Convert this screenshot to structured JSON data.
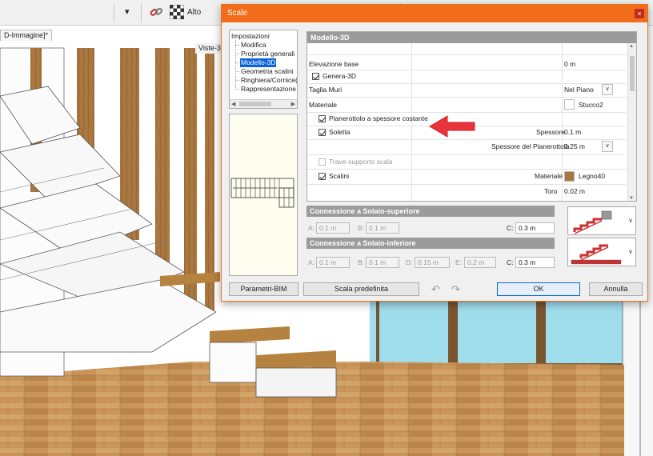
{
  "toolbar": {
    "view_label": "Alto",
    "dropdown_arrow": "▾",
    "icons": [
      "chain-link-icon",
      "checkerboard-icon"
    ]
  },
  "document_tab": "D-Immagine]*",
  "view_name": "Viste-3D",
  "dialog": {
    "title": "Scale",
    "close_glyph": "×",
    "tree": {
      "root": "Impostazioni",
      "items": [
        "Modifica",
        "Proprietà generali",
        "Modello-3D",
        "Geometria scalini",
        "Ringhiera/Cornice(+",
        "Rappresentazione s"
      ],
      "selected_index": 2
    },
    "section_title": "Modello-3D",
    "properties": {
      "elevazione_label": "Elevazione base",
      "elevazione_value": "0 m",
      "genera_label": "Genera-3D",
      "taglia_label": "Taglia Muri",
      "taglia_value": "Nel Piano",
      "materiale_label": "Materiale",
      "materiale_value": "Stucco2",
      "pianerottolo_label": "Pianerottolo a spessore costante",
      "soletta_label": "Soletta",
      "spessore_label": "Spessore",
      "spessore_value": "0.1 m",
      "spessore_pian_label": "Spessore del Pianerottolo",
      "spessore_pian_value": "0.25 m",
      "trave_label": "Trave-supporto scala",
      "scalini_label": "Scalini",
      "scalini_mat_label": "Materiale",
      "scalini_mat_value": "Legno40",
      "toro_label": "Toro",
      "toro_value": "0.02 m"
    },
    "upper": {
      "title": "Connessione a Solaio-superiore",
      "a_label": "A:",
      "a_value": "0.1 m",
      "b_label": "B:",
      "b_value": "0.1 m",
      "c_label": "C:",
      "c_value": "0.3 m"
    },
    "lower": {
      "title": "Connessione a Solaio-inferiore",
      "a_label": "A:",
      "a_value": "0.1 m",
      "b_label": "B:",
      "b_value": "0.1 m",
      "d_label": "D:",
      "d_value": "0.15 m",
      "e_label": "E:",
      "e_value": "0.2 m",
      "c_label": "C:",
      "c_value": "0.3 m"
    },
    "buttons": {
      "bim": "Parametri-BIM",
      "default": "Scala predefinita",
      "ok": "OK",
      "cancel": "Annulla"
    },
    "undo_glyph": "↶",
    "redo_glyph": "↷",
    "combo_arrow": "∨"
  },
  "colors": {
    "title_bar": "#f26d1b",
    "selection": "#0a64d6",
    "section_header": "#9b9b9b",
    "arrow": "#e8333a",
    "wood_floor": "#c9955b",
    "stair_red": "#c83232"
  }
}
